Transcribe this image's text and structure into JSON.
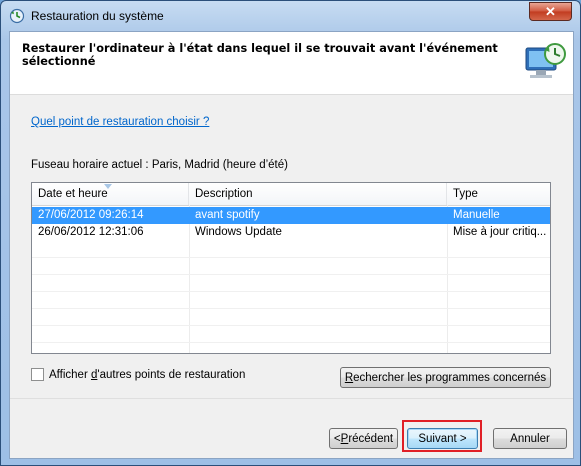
{
  "window": {
    "title": "Restauration du système",
    "close_label": "✕"
  },
  "header": {
    "title": "Restaurer l'ordinateur à l'état dans lequel il se trouvait avant l'événement sélectionné"
  },
  "help_link": "Quel point de restauration choisir ?",
  "timezone_label": "Fuseau horaire actuel : Paris, Madrid (heure d’été)",
  "table": {
    "columns": [
      "Date et heure",
      "Description",
      "Type"
    ],
    "rows": [
      {
        "date": "27/06/2012 09:26:14",
        "description": "avant spotify",
        "type": "Manuelle",
        "selected": true
      },
      {
        "date": "26/06/2012 12:31:06",
        "description": "Windows Update",
        "type": "Mise à jour critiq...",
        "selected": false
      }
    ]
  },
  "checkbox": {
    "label_pre": "Afficher ",
    "label_accel": "d",
    "label_post": "'autres points de restauration",
    "checked": false
  },
  "buttons": {
    "search_accel": "R",
    "search_rest": "echercher les programmes concernés",
    "prev_pre": "< ",
    "prev_accel": "P",
    "prev_rest": "récédent",
    "next_label": "Suivant >",
    "cancel_label": "Annuler"
  },
  "colors": {
    "selection": "#3399ff",
    "link": "#0066cc",
    "highlight_box": "#e01f26"
  }
}
